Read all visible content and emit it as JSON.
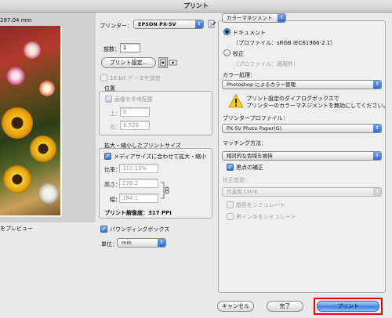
{
  "window": {
    "title": "プリント"
  },
  "preview": {
    "paper_size": "297.04 mm",
    "preview_label": "をプレビュー"
  },
  "printer": {
    "label": "プリンター：",
    "value": "EPSON PX-5V"
  },
  "copies": {
    "label": "部数：",
    "value": "1"
  },
  "print_settings_button": "プリント設定...",
  "send_16bit": "16-bit データを送信",
  "position": {
    "title": "位置",
    "center": "画像を中央配置",
    "top_label": "上：",
    "top_value": "0",
    "left_label": "左：",
    "left_value": "6.526"
  },
  "scaling": {
    "title": "拡大・縮小したプリントサイズ",
    "fit_media": "メディアサイズに合わせて拡大・縮小",
    "scale_label": "比率：",
    "scale_value": "110.13%",
    "height_label": "高さ：",
    "height_value": "276.2",
    "width_label": "幅：",
    "width_value": "184.1",
    "resolution": "プリント解像度：317 PPI"
  },
  "bounding_box": "バウンディングボックス",
  "units": {
    "label": "単位：",
    "value": "mm"
  },
  "color_management": {
    "popup": "カラーマネジメント",
    "document_radio": "ドキュメント",
    "document_profile": "（プロファイル：sRGB IEC61966-2.1）",
    "proof_radio": "校正",
    "proof_profile": "（プロファイル：適用外）",
    "color_handling_label": "カラー処理：",
    "color_handling_value": "Photoshop によるカラー管理",
    "warning_text_1": "プリント設定のダイアログボックスで",
    "warning_text_2": "プリンターのカラーマネジメントを無効にしてください。",
    "printer_profile_label": "プリンタープロファイル：",
    "printer_profile_value": "PX-5V Photo Paper(G)",
    "matching_label": "マッチング方法：",
    "matching_value": "相対的な色域を維持",
    "black_point": "黒点の補正",
    "proof_setup_label": "校正設定：",
    "proof_setup_value": "作業用 CMYK",
    "simulate_paper": "紙色をシミュレート",
    "simulate_ink": "黒インキをシミュレート"
  },
  "buttons": {
    "cancel": "キャンセル",
    "done": "完了",
    "print": "プリント"
  },
  "colors": {
    "highlight": "#e00000",
    "accent": "#3a7ee0"
  }
}
